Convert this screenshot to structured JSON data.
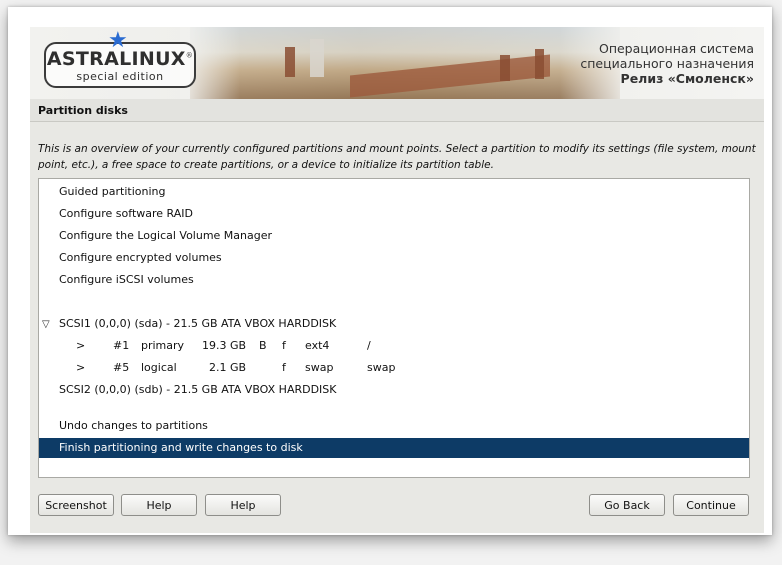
{
  "banner": {
    "logo_title": "ASTRALINUX",
    "logo_registered": "®",
    "logo_subtitle": "special edition",
    "star_icon": "blue-star-icon",
    "os_line1": "Операционная система",
    "os_line2": "специального назначения",
    "os_line3": "Релиз «Смоленск»"
  },
  "section": {
    "title": "Partition disks",
    "description": "This is an overview of your currently configured partitions and mount points. Select a partition to modify its settings (file system, mount point, etc.), a free space to create partitions, or a device to initialize its partition table."
  },
  "list": {
    "items": [
      {
        "label": "Guided partitioning"
      },
      {
        "label": "Configure software RAID"
      },
      {
        "label": "Configure the Logical Volume Manager"
      },
      {
        "label": "Configure encrypted volumes"
      },
      {
        "label": "Configure iSCSI volumes"
      }
    ],
    "disk1": {
      "label": "SCSI1 (0,0,0) (sda) - 21.5 GB ATA VBOX HARDDISK",
      "expand_icon": "triangle-down-icon"
    },
    "partitions": [
      {
        "arrow": ">",
        "num": "#1",
        "type": "primary",
        "size": "19.3 GB",
        "boot": "B",
        "fmt": "f",
        "fs": "ext4",
        "mount": "/"
      },
      {
        "arrow": ">",
        "num": "#5",
        "type": "logical",
        "size": "2.1 GB",
        "boot": "",
        "fmt": "f",
        "fs": "swap",
        "mount": "swap"
      }
    ],
    "disk2": {
      "label": "SCSI2 (0,0,0) (sdb) - 21.5 GB ATA VBOX HARDDISK"
    },
    "undo": {
      "label": "Undo changes to partitions"
    },
    "finish": {
      "label": "Finish partitioning and write changes to disk",
      "selected": true
    }
  },
  "buttons": {
    "screenshot": "Screenshot",
    "help1": "Help",
    "help2": "Help",
    "go_back": "Go Back",
    "continue": "Continue"
  },
  "colors": {
    "selection": "#0d3b66",
    "star": "#2a6bd1"
  }
}
